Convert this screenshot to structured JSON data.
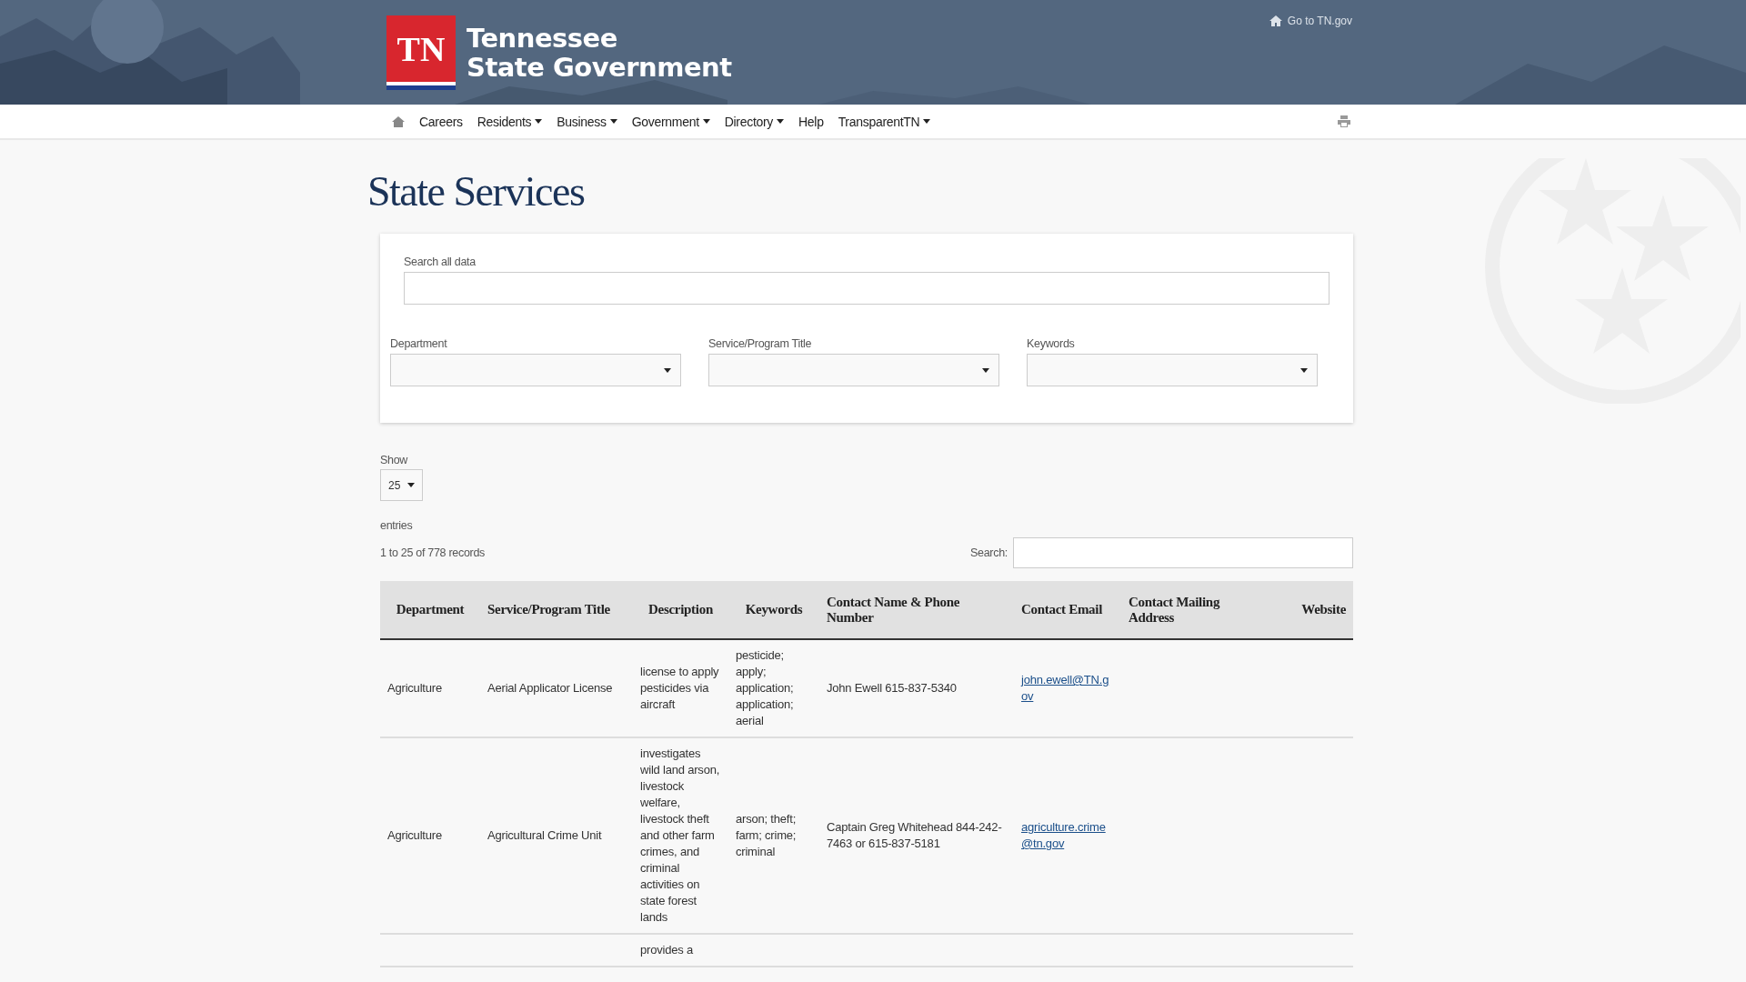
{
  "header": {
    "logo_mark": "TN",
    "logo_lines": [
      "Tennessee",
      "State Government"
    ],
    "top_link": "Go to TN.gov"
  },
  "nav": {
    "items": [
      {
        "label": "Careers",
        "has_menu": false
      },
      {
        "label": "Residents",
        "has_menu": true
      },
      {
        "label": "Business",
        "has_menu": true
      },
      {
        "label": "Government",
        "has_menu": true
      },
      {
        "label": "Directory",
        "has_menu": true
      },
      {
        "label": "Help",
        "has_menu": false
      },
      {
        "label": "TransparentTN",
        "has_menu": true
      }
    ]
  },
  "page_title": "State Services",
  "filters": {
    "search_label": "Search all data",
    "selects": [
      {
        "label": "Department"
      },
      {
        "label": "Service/Program Title"
      },
      {
        "label": "Keywords"
      }
    ]
  },
  "table_controls": {
    "show_label": "Show",
    "page_size": "25",
    "entries_label": "entries",
    "record_info": "1 to 25 of 778 records",
    "search_label": "Search:"
  },
  "table": {
    "columns": [
      "Department",
      "Service/Program Title",
      "Description",
      "Keywords",
      "Contact Name & Phone Number",
      "Contact Email",
      "Contact Mailing Address",
      "Website"
    ],
    "rows": [
      {
        "department": "Agriculture",
        "title": "Aerial Applicator License",
        "description": "license to apply pesticides via aircraft",
        "keywords": "pesticide; apply; application; application; aerial",
        "contact": "John Ewell 615-837-5340",
        "email": "john.ewell@TN.gov"
      },
      {
        "department": "Agriculture",
        "title": "Agricultural Crime Unit",
        "description": "investigates wild land arson, livestock welfare, livestock theft and other farm crimes, and criminal activities on state forest lands",
        "keywords": "arson; theft; farm; crime; criminal",
        "contact": "Captain Greg Whitehead 844-242-7463 or 615-837-5181",
        "email": "agriculture.crime@tn.gov"
      },
      {
        "description": "provides a"
      }
    ]
  }
}
